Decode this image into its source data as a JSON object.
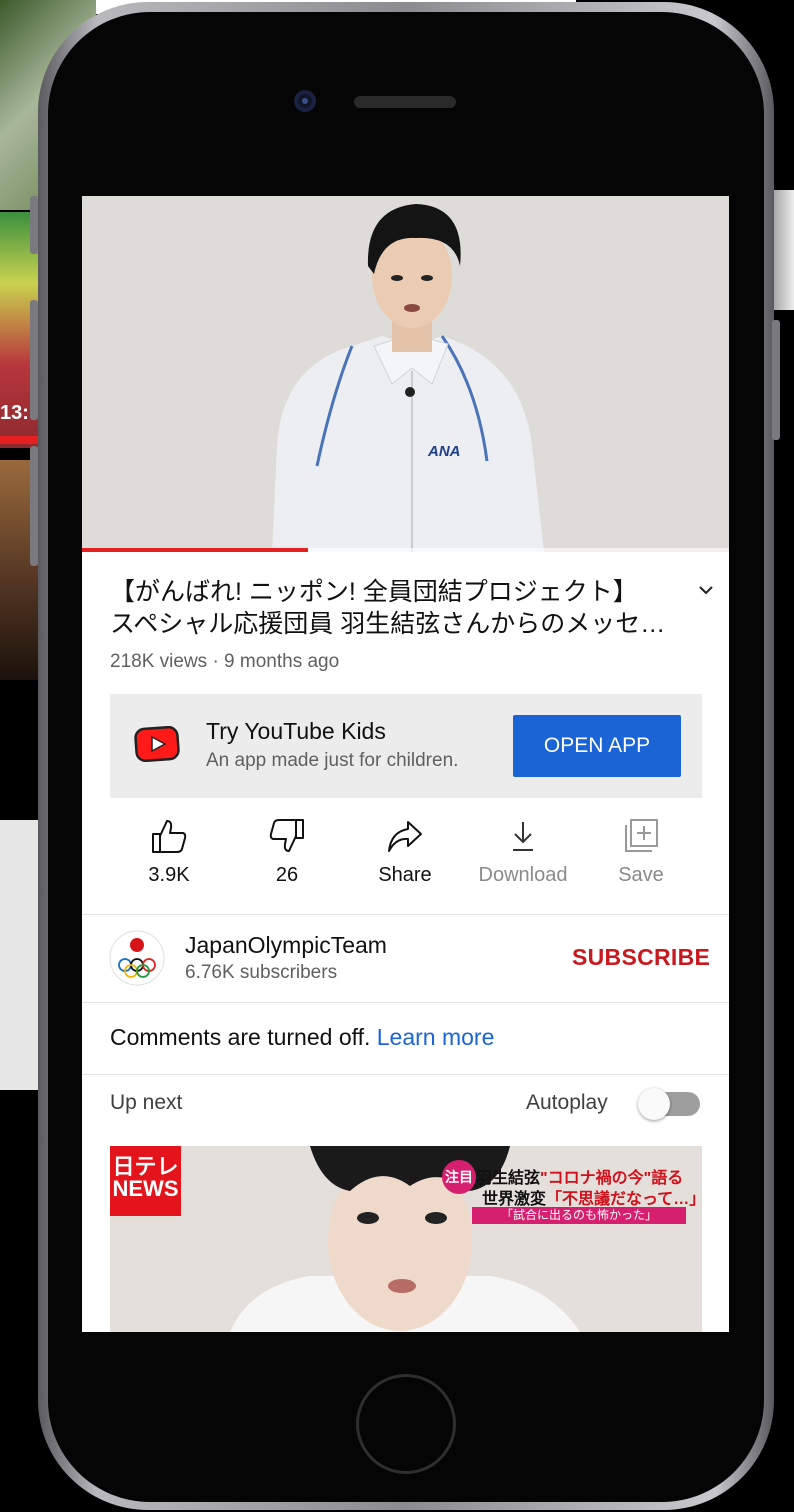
{
  "video": {
    "title_line1": "【がんばれ! ニッポン! 全員団結プロジェクト】",
    "title_line2": "スペシャル応援団員 羽生結弦さんからのメッセ…",
    "meta": "218K views · 9 months ago",
    "progress_fraction": 0.35,
    "jacket_logo": "ANA"
  },
  "promo": {
    "title": "Try YouTube Kids",
    "subtitle": "An app made just for children.",
    "button_label": "OPEN APP",
    "icon": "youtube-kids-play-icon"
  },
  "actions": [
    {
      "label": "3.9K",
      "icon": "thumbs-up-icon"
    },
    {
      "label": "26",
      "icon": "thumbs-down-icon"
    },
    {
      "label": "Share",
      "icon": "share-icon"
    },
    {
      "label": "Download",
      "icon": "download-icon"
    },
    {
      "label": "Save",
      "icon": "add-to-playlist-icon"
    }
  ],
  "channel": {
    "name": "JapanOlympicTeam",
    "subscribers": "6.76K subscribers",
    "subscribe_label": "SUBSCRIBE"
  },
  "comments": {
    "text": "Comments are turned off.",
    "link": "Learn more"
  },
  "up_next": {
    "label": "Up next",
    "autoplay_label": "Autoplay",
    "autoplay_on": false
  },
  "next_video": {
    "logo_line1": "日テレ",
    "logo_line2": "NEWS",
    "badge": "注目",
    "caption_line1a": "羽生結弦",
    "caption_line1b": "\"コロナ禍の今\"語る",
    "caption_line2a": "世界激変",
    "caption_line2b": "「不思議だなって…」",
    "caption_line3": "「試合に出るのも怖かった」"
  },
  "background": {
    "left_thumb_text": "13:"
  },
  "colors": {
    "accent_blue": "#1a64d6",
    "subscribe_red": "#c8191f",
    "progress_red": "#e52020",
    "promo_bg": "#ececec"
  }
}
